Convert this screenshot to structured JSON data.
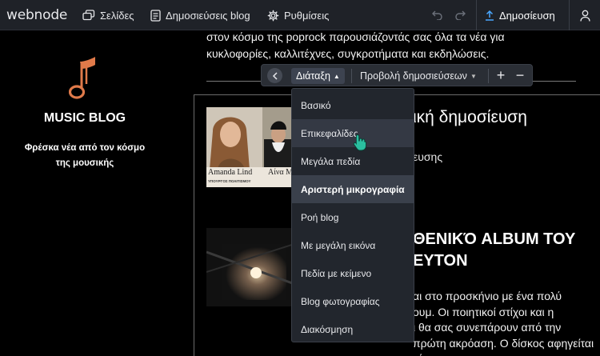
{
  "app": {
    "logo": "webnode",
    "nav": [
      {
        "label": "Σελίδες",
        "icon": "pages-icon"
      },
      {
        "label": "Δημοσιεύσεις blog",
        "icon": "blog-posts-icon"
      },
      {
        "label": "Ρυθμίσεις",
        "icon": "gear-icon"
      }
    ],
    "publish_label": "Δημοσίευση"
  },
  "sidebar": {
    "logo_icon": "music-note-icon",
    "accent_color": "#e07a4a",
    "title": "MUSIC BLOG",
    "subtitle_line1": "Φρέσκα νέα από τον κόσμο",
    "subtitle_line2": "της μουσικής"
  },
  "main": {
    "intro_line1": "στον κόσμο της poprock παρουσιάζοντάς σας όλα τα νέα για",
    "intro_line2": "κυκλοφορίες, καλλιτέχνες, συγκροτήματα και εκδηλώσεις.",
    "post1": {
      "title_visible": "ική δημοσίευση",
      "date_visible": "ευσης",
      "image_caption_left": "Amanda Lind",
      "image_caption_right": "Αίνα Μ",
      "image_subcaption": "ΥΠΟΥΡΓΟΣ ΠΟΛΙΤΙΣΜΟΥ"
    },
    "post2": {
      "title_line1": "ΘΕΝΙΚΌ ALBUM ΤΟΥ",
      "title_line2": "ΕΥΤΟΝ",
      "text_line1": "αι στο προσκήνιο με ένα πολύ",
      "text_line2": "ουμ. Οι ποιητικοί στίχοι και η",
      "text_line3": "ι θα σας συνεπάρουν από την",
      "text_line4": "πρώτη ακρόαση. Ο δίσκος αφηγείται μία"
    }
  },
  "blog_toolbar": {
    "layout_label": "Διάταξη",
    "view_label": "Προβολή δημοσιεύσεων",
    "plus": "+",
    "minus": "−"
  },
  "layout_menu": {
    "hovered_index": 1,
    "selected_index": 3,
    "items": [
      "Βασικό",
      "Επικεφαλίδες",
      "Μεγάλα πεδία",
      "Αριστερή μικρογραφία",
      "Ροή blog",
      "Με μεγάλη εικόνα",
      "Πεδία με κείμενο",
      "Blog φωτογραφίας",
      "Διακόσμηση"
    ]
  },
  "colors": {
    "topbar_bg": "#1f2228",
    "menu_bg": "#22262d",
    "cursor_color": "#2bbfa0"
  }
}
